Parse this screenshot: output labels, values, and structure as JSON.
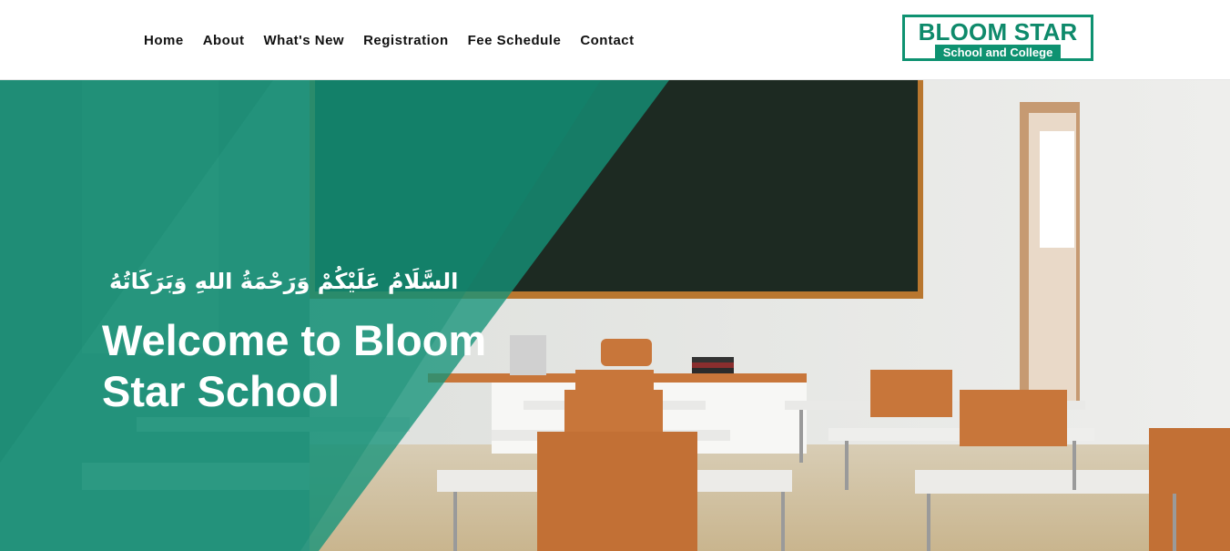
{
  "nav": {
    "items": [
      "Home",
      "About",
      "What's New",
      "Registration",
      "Fee Schedule",
      "Contact"
    ]
  },
  "logo": {
    "title": "BLOOM STAR",
    "subtitle": "School and College"
  },
  "hero": {
    "greeting": "السَّلَامُ عَلَيْكُمْ وَرَحْمَةُ اللهِ وَبَرَكَاتُهُ",
    "title": "Welcome to Bloom Star School"
  },
  "colors": {
    "brand": "#0e9271",
    "overlay": "#1a9a7c",
    "chalkboard": "#1d2a22",
    "chair": "#c8763a"
  }
}
